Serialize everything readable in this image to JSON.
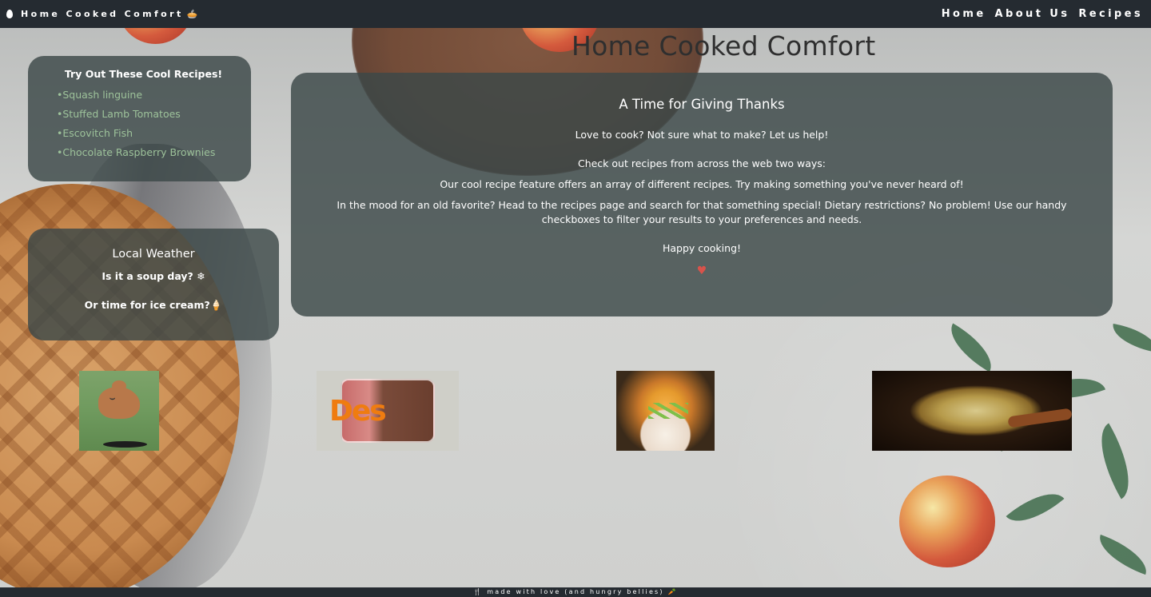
{
  "nav": {
    "brand": "Home Cooked Comfort",
    "brand_icon_left": "drop-icon",
    "brand_icon_right": "pie-icon",
    "links": [
      "Home",
      "About Us",
      "Recipes"
    ]
  },
  "page_title": "Home Cooked Comfort",
  "recipes_card": {
    "title": "Try Out These Cool Recipes!",
    "items": [
      "Squash linguine",
      "Stuffed Lamb Tomatoes",
      "Escovitch Fish",
      "Chocolate Raspberry Brownies"
    ],
    "link_color": "#9dc29a"
  },
  "weather_card": {
    "title": "Local Weather",
    "line1": "Is it a soup day? ❄",
    "line2": "Or time for ice cream?🍦"
  },
  "main_card": {
    "title": "A Time for Giving Thanks",
    "p1": "Love to cook? Not sure what to make? Let us help!",
    "p2": "Check out recipes from across the web two ways:",
    "p3": "Our cool recipe feature offers an array of different recipes. Try making something you've never heard of!",
    "p4": "In the mood for an old favorite? Head to the recipes page and search for that something special! Dietary restrictions? No problem! Use our handy checkboxes to filter your results to your preferences and needs.",
    "p5": "Happy cooking!",
    "heart": "♥",
    "heart_color": "#d8534b"
  },
  "tiles": {
    "dessert_overlay_text": "Des"
  },
  "footer": {
    "text": "🍴 made with love (and hungry bellies) 🥕"
  },
  "colors": {
    "nav_bg": "#252b31",
    "panel_bg": "rgba(60, 72, 72, 0.82)"
  }
}
